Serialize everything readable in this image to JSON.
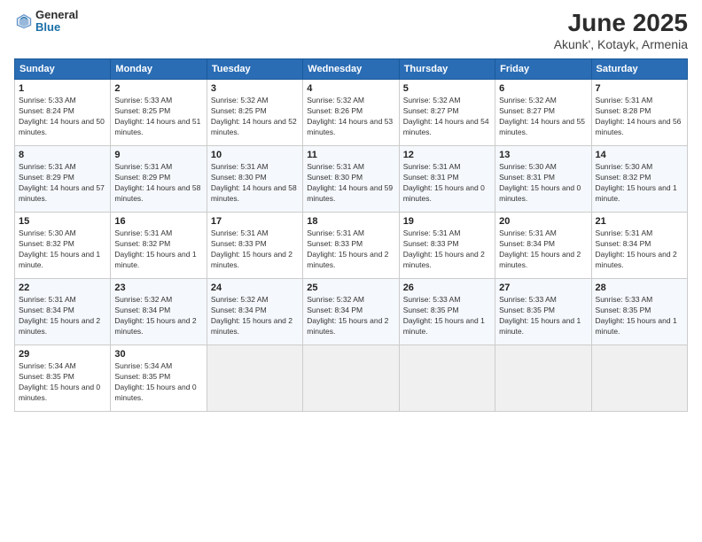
{
  "header": {
    "logo_general": "General",
    "logo_blue": "Blue",
    "title": "June 2025",
    "subtitle": "Akunk', Kotayk, Armenia"
  },
  "weekdays": [
    "Sunday",
    "Monday",
    "Tuesday",
    "Wednesday",
    "Thursday",
    "Friday",
    "Saturday"
  ],
  "weeks": [
    [
      {
        "day": "1",
        "sunrise": "5:33 AM",
        "sunset": "8:24 PM",
        "daylight": "14 hours and 50 minutes."
      },
      {
        "day": "2",
        "sunrise": "5:33 AM",
        "sunset": "8:25 PM",
        "daylight": "14 hours and 51 minutes."
      },
      {
        "day": "3",
        "sunrise": "5:32 AM",
        "sunset": "8:25 PM",
        "daylight": "14 hours and 52 minutes."
      },
      {
        "day": "4",
        "sunrise": "5:32 AM",
        "sunset": "8:26 PM",
        "daylight": "14 hours and 53 minutes."
      },
      {
        "day": "5",
        "sunrise": "5:32 AM",
        "sunset": "8:27 PM",
        "daylight": "14 hours and 54 minutes."
      },
      {
        "day": "6",
        "sunrise": "5:32 AM",
        "sunset": "8:27 PM",
        "daylight": "14 hours and 55 minutes."
      },
      {
        "day": "7",
        "sunrise": "5:31 AM",
        "sunset": "8:28 PM",
        "daylight": "14 hours and 56 minutes."
      }
    ],
    [
      {
        "day": "8",
        "sunrise": "5:31 AM",
        "sunset": "8:29 PM",
        "daylight": "14 hours and 57 minutes."
      },
      {
        "day": "9",
        "sunrise": "5:31 AM",
        "sunset": "8:29 PM",
        "daylight": "14 hours and 58 minutes."
      },
      {
        "day": "10",
        "sunrise": "5:31 AM",
        "sunset": "8:30 PM",
        "daylight": "14 hours and 58 minutes."
      },
      {
        "day": "11",
        "sunrise": "5:31 AM",
        "sunset": "8:30 PM",
        "daylight": "14 hours and 59 minutes."
      },
      {
        "day": "12",
        "sunrise": "5:31 AM",
        "sunset": "8:31 PM",
        "daylight": "15 hours and 0 minutes."
      },
      {
        "day": "13",
        "sunrise": "5:30 AM",
        "sunset": "8:31 PM",
        "daylight": "15 hours and 0 minutes."
      },
      {
        "day": "14",
        "sunrise": "5:30 AM",
        "sunset": "8:32 PM",
        "daylight": "15 hours and 1 minute."
      }
    ],
    [
      {
        "day": "15",
        "sunrise": "5:30 AM",
        "sunset": "8:32 PM",
        "daylight": "15 hours and 1 minute."
      },
      {
        "day": "16",
        "sunrise": "5:31 AM",
        "sunset": "8:32 PM",
        "daylight": "15 hours and 1 minute."
      },
      {
        "day": "17",
        "sunrise": "5:31 AM",
        "sunset": "8:33 PM",
        "daylight": "15 hours and 2 minutes."
      },
      {
        "day": "18",
        "sunrise": "5:31 AM",
        "sunset": "8:33 PM",
        "daylight": "15 hours and 2 minutes."
      },
      {
        "day": "19",
        "sunrise": "5:31 AM",
        "sunset": "8:33 PM",
        "daylight": "15 hours and 2 minutes."
      },
      {
        "day": "20",
        "sunrise": "5:31 AM",
        "sunset": "8:34 PM",
        "daylight": "15 hours and 2 minutes."
      },
      {
        "day": "21",
        "sunrise": "5:31 AM",
        "sunset": "8:34 PM",
        "daylight": "15 hours and 2 minutes."
      }
    ],
    [
      {
        "day": "22",
        "sunrise": "5:31 AM",
        "sunset": "8:34 PM",
        "daylight": "15 hours and 2 minutes."
      },
      {
        "day": "23",
        "sunrise": "5:32 AM",
        "sunset": "8:34 PM",
        "daylight": "15 hours and 2 minutes."
      },
      {
        "day": "24",
        "sunrise": "5:32 AM",
        "sunset": "8:34 PM",
        "daylight": "15 hours and 2 minutes."
      },
      {
        "day": "25",
        "sunrise": "5:32 AM",
        "sunset": "8:34 PM",
        "daylight": "15 hours and 2 minutes."
      },
      {
        "day": "26",
        "sunrise": "5:33 AM",
        "sunset": "8:35 PM",
        "daylight": "15 hours and 1 minute."
      },
      {
        "day": "27",
        "sunrise": "5:33 AM",
        "sunset": "8:35 PM",
        "daylight": "15 hours and 1 minute."
      },
      {
        "day": "28",
        "sunrise": "5:33 AM",
        "sunset": "8:35 PM",
        "daylight": "15 hours and 1 minute."
      }
    ],
    [
      {
        "day": "29",
        "sunrise": "5:34 AM",
        "sunset": "8:35 PM",
        "daylight": "15 hours and 0 minutes."
      },
      {
        "day": "30",
        "sunrise": "5:34 AM",
        "sunset": "8:35 PM",
        "daylight": "15 hours and 0 minutes."
      },
      null,
      null,
      null,
      null,
      null
    ]
  ]
}
